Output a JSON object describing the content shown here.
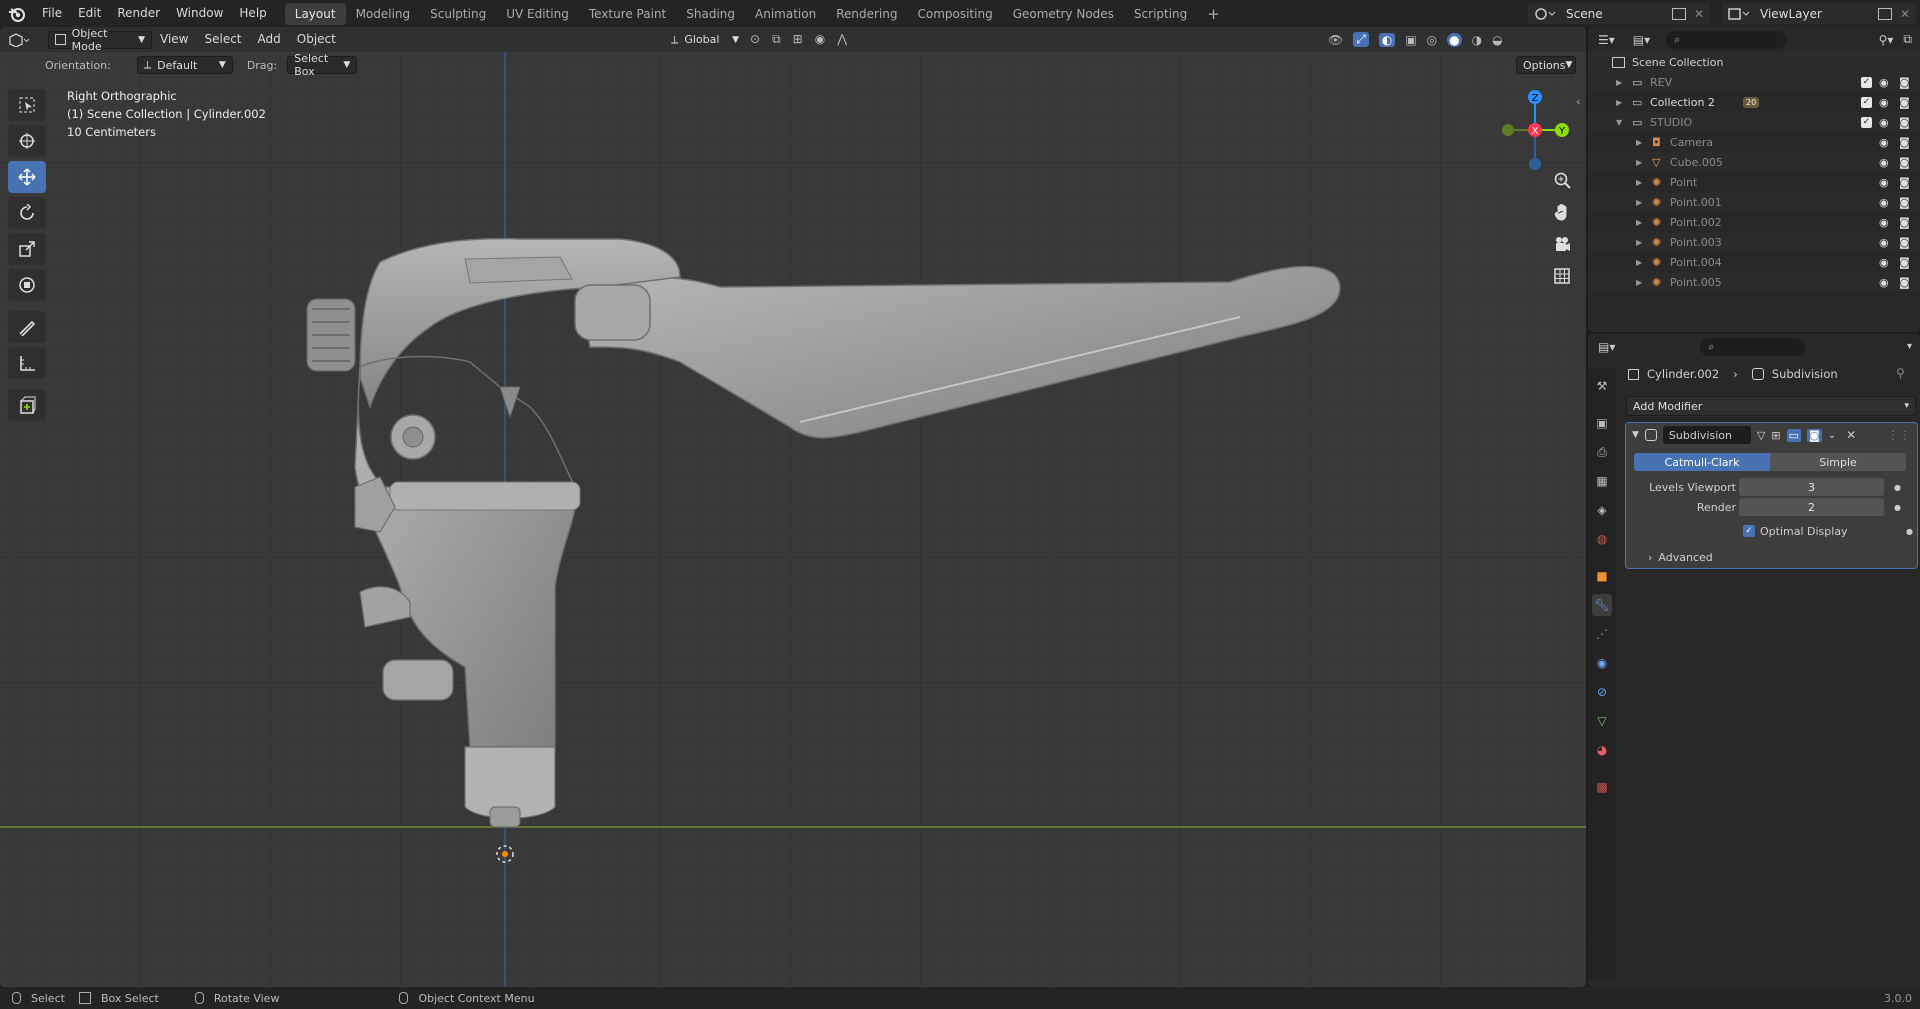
{
  "menu": {
    "items": [
      "File",
      "Edit",
      "Render",
      "Window",
      "Help"
    ]
  },
  "workspaces": [
    "Layout",
    "Modeling",
    "Sculpting",
    "UV Editing",
    "Texture Paint",
    "Shading",
    "Animation",
    "Rendering",
    "Compositing",
    "Geometry Nodes",
    "Scripting"
  ],
  "active_workspace": "Layout",
  "add_tab": "+",
  "scene": {
    "label": "Scene"
  },
  "view_layer": {
    "label": "ViewLayer"
  },
  "viewport_header": {
    "mode": "Object Mode",
    "view": "View",
    "select": "Select",
    "add": "Add",
    "object": "Object",
    "transform_orientation": "Global"
  },
  "tool_settings": {
    "orientation_label": "Orientation:",
    "orientation_value": "Default",
    "drag_label": "Drag:",
    "drag_value": "Select Box",
    "options": "Options"
  },
  "overlay": {
    "view_name": "Right Orthographic",
    "collection": "(1) Scene Collection | Cylinder.002",
    "scale": "10 Centimeters"
  },
  "gizmo": {
    "z": "Z",
    "y": "Y",
    "x": "X"
  },
  "outliner": {
    "root": "Scene Collection",
    "rows": [
      {
        "label": "REV",
        "indent": 1,
        "type": "collection",
        "dim": true
      },
      {
        "label": "Collection 2",
        "indent": 1,
        "type": "collection",
        "dim": false,
        "badge": "20"
      },
      {
        "label": "STUDIO",
        "indent": 1,
        "type": "collection",
        "dim": true
      },
      {
        "label": "Camera",
        "indent": 2,
        "type": "camera",
        "dim": true
      },
      {
        "label": "Cube.005",
        "indent": 2,
        "type": "mesh",
        "dim": true
      },
      {
        "label": "Point",
        "indent": 2,
        "type": "light",
        "dim": true
      },
      {
        "label": "Point.001",
        "indent": 2,
        "type": "light",
        "dim": true
      },
      {
        "label": "Point.002",
        "indent": 2,
        "type": "light",
        "dim": true
      },
      {
        "label": "Point.003",
        "indent": 2,
        "type": "light",
        "dim": true
      },
      {
        "label": "Point.004",
        "indent": 2,
        "type": "light",
        "dim": true
      },
      {
        "label": "Point.005",
        "indent": 2,
        "type": "light",
        "dim": true
      }
    ]
  },
  "properties": {
    "object": "Cylinder.002",
    "modifier_path": "Subdivision",
    "add_modifier": "Add Modifier",
    "modifier": {
      "name": "Subdivision",
      "type_a": "Catmull-Clark",
      "type_b": "Simple",
      "active_type": "Catmull-Clark",
      "levels_viewport_label": "Levels Viewport",
      "levels_viewport": "3",
      "render_label": "Render",
      "render": "2",
      "optimal_display_label": "Optimal Display",
      "optimal_display": true,
      "advanced": "Advanced"
    }
  },
  "status": {
    "select": "Select",
    "box_select": "Box Select",
    "rotate": "Rotate View",
    "context": "Object Context Menu",
    "version": "3.0.0"
  },
  "colors": {
    "accent": "#4772b3",
    "x_axis": "#ff3352",
    "y_axis": "#8bdc00",
    "z_axis": "#2890ff",
    "lever": "#9a9a9a",
    "grid_bg": "#393939"
  }
}
